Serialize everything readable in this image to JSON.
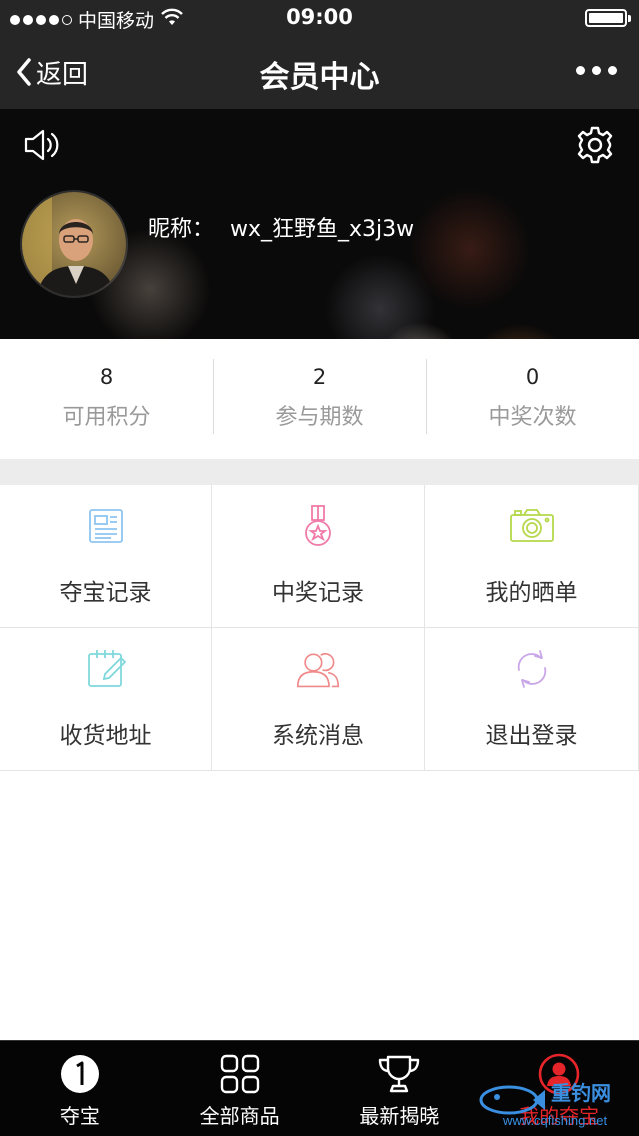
{
  "status_bar": {
    "carrier": "中国移动",
    "time": "09:00"
  },
  "nav": {
    "back_label": "返回",
    "title": "会员中心"
  },
  "profile": {
    "nickname_label": "昵称：",
    "nickname": "wx_狂野鱼_x3j3w"
  },
  "stats": [
    {
      "value": "8",
      "label": "可用积分"
    },
    {
      "value": "2",
      "label": "参与期数"
    },
    {
      "value": "0",
      "label": "中奖次数"
    }
  ],
  "menu": [
    {
      "label": "夺宝记录",
      "icon": "document-icon",
      "color": "#8ec5f0"
    },
    {
      "label": "中奖记录",
      "icon": "medal-icon",
      "color": "#f07aa8"
    },
    {
      "label": "我的晒单",
      "icon": "camera-icon",
      "color": "#b5d84a"
    },
    {
      "label": "收货地址",
      "icon": "notepad-edit-icon",
      "color": "#7fd8dc"
    },
    {
      "label": "系统消息",
      "icon": "users-icon",
      "color": "#f08a8a"
    },
    {
      "label": "退出登录",
      "icon": "refresh-icon",
      "color": "#c9a6e8"
    }
  ],
  "tabs": [
    {
      "label": "夺宝",
      "icon": "number-one-icon"
    },
    {
      "label": "全部商品",
      "icon": "grid-icon"
    },
    {
      "label": "最新揭晓",
      "icon": "trophy-icon"
    },
    {
      "label": "我的夺宝",
      "icon": "user-circle-icon",
      "active": true
    }
  ],
  "watermark": {
    "brand": "重钓网",
    "url": "www.cqfishing.net"
  }
}
